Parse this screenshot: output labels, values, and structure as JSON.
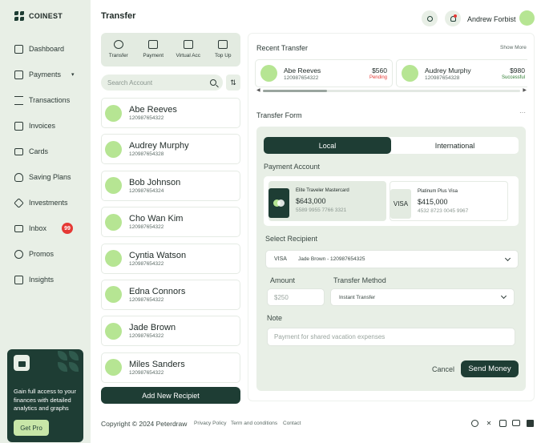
{
  "brand": {
    "name": "COINEST"
  },
  "nav": {
    "items": [
      {
        "label": "Dashboard",
        "icon": "grid-icon"
      },
      {
        "label": "Payments",
        "icon": "wallet-icon",
        "chevron": "▾"
      },
      {
        "label": "Transactions",
        "icon": "arrows-icon"
      },
      {
        "label": "Invoices",
        "icon": "invoice-icon"
      },
      {
        "label": "Cards",
        "icon": "card-icon"
      },
      {
        "label": "Saving Plans",
        "icon": "piggy-bank-icon"
      },
      {
        "label": "Investments",
        "icon": "investment-icon"
      },
      {
        "label": "Inbox",
        "icon": "mail-icon",
        "badge": "99"
      },
      {
        "label": "Promos",
        "icon": "promo-icon"
      },
      {
        "label": "Insights",
        "icon": "insights-icon"
      }
    ]
  },
  "promo": {
    "text": "Gain full access to your finances with detailed analytics and graphs",
    "button": "Get Pro"
  },
  "header": {
    "title": "Transfer",
    "user_name": "Andrew Forbist"
  },
  "quick_actions": [
    {
      "label": "Transfer",
      "icon": "transfer-icon"
    },
    {
      "label": "Payment",
      "icon": "payment-icon"
    },
    {
      "label": "Virtual Acc",
      "icon": "virtual-account-icon"
    },
    {
      "label": "Top Up",
      "icon": "top-up-icon"
    }
  ],
  "search": {
    "placeholder": "Search Account",
    "sort_glyph": "⇅"
  },
  "contacts": [
    {
      "name": "Abe Reeves",
      "account": "120987654322"
    },
    {
      "name": "Audrey Murphy",
      "account": "120987654328"
    },
    {
      "name": "Bob Johnson",
      "account": "120987654324"
    },
    {
      "name": "Cho Wan Kim",
      "account": "120987654322"
    },
    {
      "name": "Cyntia Watson",
      "account": "120987654322"
    },
    {
      "name": "Edna Connors",
      "account": "120987654322"
    },
    {
      "name": "Jade Brown",
      "account": "120987654322"
    },
    {
      "name": "Miles Sanders",
      "account": "120987654322"
    }
  ],
  "add_button": "Add New Recipiet",
  "recent": {
    "title": "Recent Transfer",
    "show_more": "Show More",
    "items": [
      {
        "name": "Abe Reeves",
        "account": "120987654322",
        "amount": "$560",
        "status": "Pending",
        "status_color": "#e53935"
      },
      {
        "name": "Audrey Murphy",
        "account": "120987654328",
        "amount": "$980",
        "status": "Successful",
        "status_color": "#2e7d32"
      }
    ],
    "scroll_left": "◀",
    "scroll_right": "▶"
  },
  "form": {
    "title": "Transfer Form",
    "more": "···",
    "tabs": [
      "Local",
      "International"
    ],
    "payment_account_label": "Payment Account",
    "cards": [
      {
        "name": "Elite Traveler Mastercard",
        "balance": "$643,000",
        "number": "5589 9955 7766 3321"
      },
      {
        "name": "Platinum Plus Visa",
        "balance": "$415,000",
        "number": "4532 8723 0045 9967",
        "brand": "VISA"
      }
    ],
    "recipient_label": "Select Recipient",
    "recipient_brand": "VISA",
    "recipient_value": "Jade Brown - 120987654325",
    "amount_label": "Amount",
    "amount_placeholder": "$250",
    "method_label": "Transfer Method",
    "method_value": "Instant Transfer",
    "note_label": "Note",
    "note_placeholder": "Payment for shared vacation expenses",
    "cancel": "Cancel",
    "send": "Send Money"
  },
  "footer": {
    "copyright": "Copyright © 2024 Peterdraw",
    "links": [
      "Privacy Policy",
      "Term and conditions",
      "Contact"
    ],
    "social": [
      "facebook-icon",
      "x-icon",
      "instagram-icon",
      "youtube-icon",
      "linkedin-icon"
    ]
  },
  "colors": {
    "primary": "#1e3d34",
    "accent": "#b6e593",
    "surface": "#e8efe6",
    "danger": "#e53935"
  }
}
